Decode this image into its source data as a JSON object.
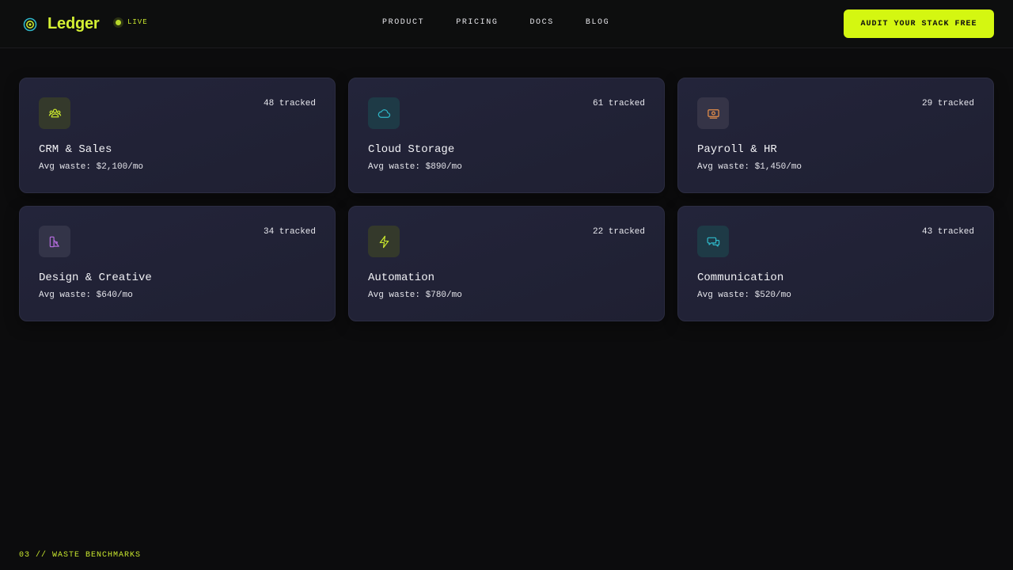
{
  "header": {
    "logo_text": "Ledger",
    "live_label": "LIVE",
    "nav": [
      "PRODUCT",
      "PRICING",
      "DOCS",
      "BLOG"
    ],
    "cta_label": "AUDIT YOUR STACK FREE"
  },
  "cards": [
    {
      "title": "CRM & Sales",
      "tracked": "48 tracked",
      "waste": "Avg waste: $2,100/mo",
      "icon": "users-icon",
      "icon_color": "#c8e62e",
      "icon_bg": "#34392b"
    },
    {
      "title": "Cloud Storage",
      "tracked": "61 tracked",
      "waste": "Avg waste: $890/mo",
      "icon": "cloud-icon",
      "icon_color": "#2fb8c9",
      "icon_bg": "#1e3a46"
    },
    {
      "title": "Payroll & HR",
      "tracked": "29 tracked",
      "waste": "Avg waste: $1,450/mo",
      "icon": "money-icon",
      "icon_color": "#e8904a",
      "icon_bg": "#353447"
    },
    {
      "title": "Design & Creative",
      "tracked": "34 tracked",
      "waste": "Avg waste: $640/mo",
      "icon": "shapes-icon",
      "icon_color": "#b06ad8",
      "icon_bg": "#333448"
    },
    {
      "title": "Automation",
      "tracked": "22 tracked",
      "waste": "Avg waste: $780/mo",
      "icon": "bolt-icon",
      "icon_color": "#c8e62e",
      "icon_bg": "#34392b"
    },
    {
      "title": "Communication",
      "tracked": "43 tracked",
      "waste": "Avg waste: $520/mo",
      "icon": "chat-icon",
      "icon_color": "#2fb8c9",
      "icon_bg": "#1e3a46"
    }
  ],
  "footer": {
    "section_label": "03 // WASTE BENCHMARKS"
  },
  "colors": {
    "accent": "#d4f711",
    "background": "#0c0c0d",
    "card": "#22233a"
  }
}
